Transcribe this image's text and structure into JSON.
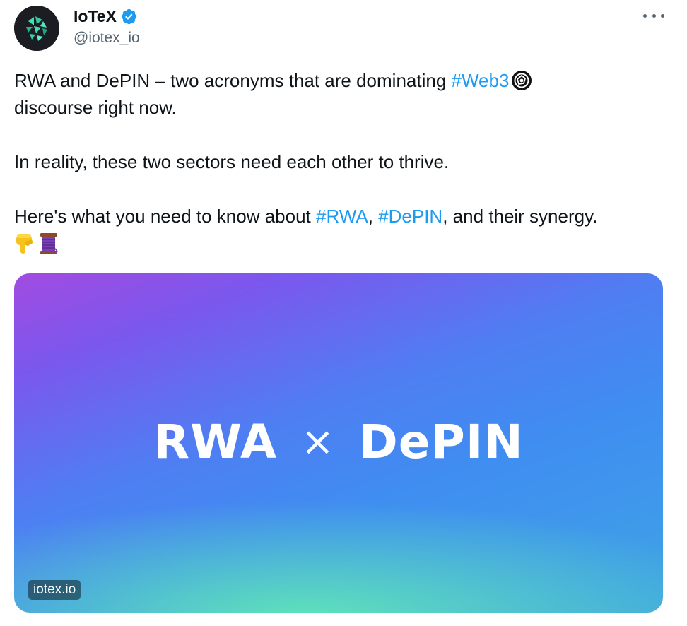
{
  "author": {
    "display_name": "IoTeX",
    "handle": "@iotex_io",
    "verified": true,
    "verified_color": "#1d9bf0",
    "avatar_icon": "iotex-logo-icon"
  },
  "menu": {
    "icon": "more-horizontal-icon"
  },
  "tweet": {
    "line1_prefix": "RWA and DePIN – two acronyms that are dominating ",
    "hashtag_web3": "#Web3",
    "web3_emoji": "web3-swirl-icon",
    "line2": "discourse right now.",
    "para2": "In reality, these two sectors need each other to thrive.",
    "para3_prefix": "Here's what you need to know about ",
    "hashtag_rwa": "#RWA",
    "sep": ", ",
    "hashtag_depin": "#DePIN",
    "para3_suffix": ", and their synergy.",
    "emojis": [
      "👇",
      "🧵"
    ]
  },
  "media": {
    "left_word": "RWA",
    "times": "×",
    "right_word": "DePIN",
    "link_badge": "iotex.io"
  },
  "colors": {
    "link": "#1d9bf0",
    "text": "#0f1419",
    "muted": "#536471"
  }
}
